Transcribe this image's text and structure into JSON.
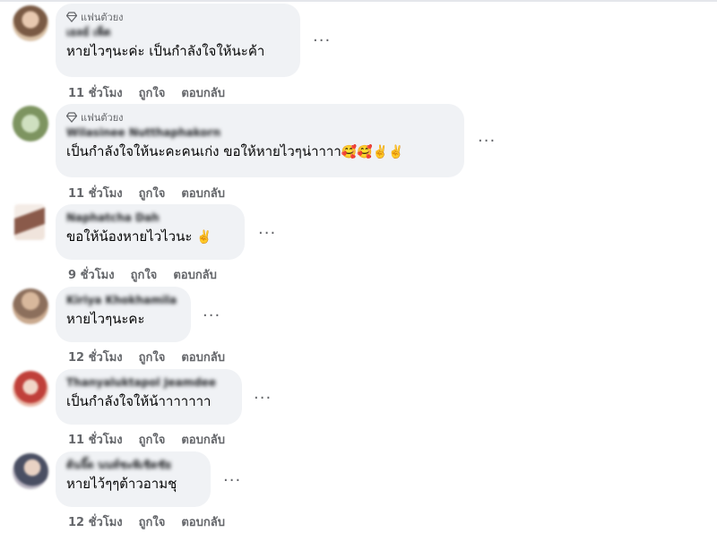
{
  "comments": [
    {
      "badge": "แฟนตัวยง",
      "author": "เยลย์ เพ็ต",
      "text": "หายไวๆนะค่ะ เป็นกำลังใจให้นะค้า",
      "emoji": "",
      "time": "11 ชั่วโมง",
      "like": "ถูกใจ",
      "reply": "ตอบกลับ",
      "more": "···"
    },
    {
      "badge": "แฟนตัวยง",
      "author": "Wilasinee Nutthaphakorn",
      "text": "เป็นกำลังใจให้นะคะคนเก่ง ขอให้หายไวๆน่าาาา",
      "emoji": "🥰🥰✌️✌️",
      "time": "11 ชั่วโมง",
      "like": "ถูกใจ",
      "reply": "ตอบกลับ",
      "more": "···"
    },
    {
      "badge": "",
      "author": "Naphatcha Dah",
      "text": "ขอให้น้องหายไวไวนะ",
      "emoji": "✌️",
      "time": "9 ชั่วโมง",
      "like": "ถูกใจ",
      "reply": "ตอบกลับ",
      "more": "···"
    },
    {
      "badge": "",
      "author": "Kiriya Khokhamila",
      "text": "หายไวๆนะคะ",
      "emoji": "",
      "time": "12 ชั่วโมง",
      "like": "ถูกใจ",
      "reply": "ตอบกลับ",
      "more": "···"
    },
    {
      "badge": "",
      "author": "Thanyaluktapol Jeamdee",
      "text": "เป็นกำลังใจให้น้าาาาาาา",
      "emoji": "",
      "time": "11 ชั่วโมง",
      "like": "ถูกใจ",
      "reply": "ตอบกลับ",
      "more": "···"
    },
    {
      "badge": "",
      "author": "ต้นจิ๊ด นนท์ชะพิเชิดชัย",
      "text": "หายไว้ๆๆต้าวอามชุ",
      "emoji": "",
      "time": "12 ชั่วโมง",
      "like": "ถูกใจ",
      "reply": "ตอบกลับ",
      "more": "···"
    }
  ],
  "colors": {
    "bubble": "#f0f2f5",
    "meta": "#65676b",
    "text": "#050505"
  }
}
